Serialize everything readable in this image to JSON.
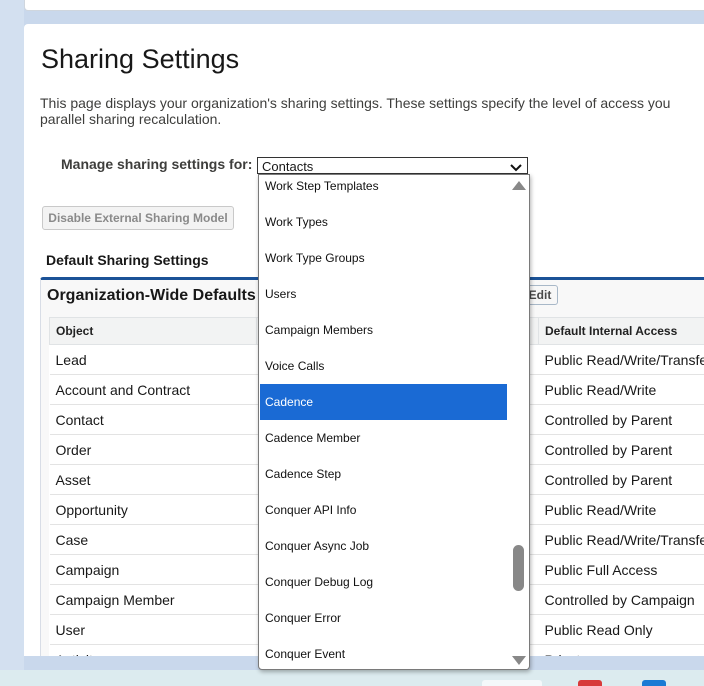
{
  "page": {
    "title": "Sharing Settings",
    "description_line1": "This page displays your organization's sharing settings. These settings specify the level of access you",
    "description_line2": "parallel sharing recalculation."
  },
  "manage": {
    "label": "Manage sharing settings for:",
    "selected": "Contacts"
  },
  "buttons": {
    "disable_external": "Disable External Sharing Model",
    "edit": "Edit"
  },
  "section": {
    "default_sharing": "Default Sharing Settings",
    "owd_title": "Organization-Wide Defaults"
  },
  "table": {
    "headers": [
      "Object",
      "",
      "Default Internal Access"
    ],
    "rows": [
      {
        "object": "Lead",
        "access": "Public Read/Write/Transfer"
      },
      {
        "object": "Account and Contract",
        "access": "Public Read/Write"
      },
      {
        "object": "Contact",
        "access": "Controlled by Parent"
      },
      {
        "object": "Order",
        "access": "Controlled by Parent"
      },
      {
        "object": "Asset",
        "access": "Controlled by Parent"
      },
      {
        "object": "Opportunity",
        "access": "Public Read/Write"
      },
      {
        "object": "Case",
        "access": "Public Read/Write/Transfer"
      },
      {
        "object": "Campaign",
        "access": "Public Full Access"
      },
      {
        "object": "Campaign Member",
        "access": "Controlled by Campaign"
      },
      {
        "object": "User",
        "access": "Public Read Only"
      },
      {
        "object": "Activity",
        "access": "Private"
      }
    ]
  },
  "dropdown": {
    "items": [
      "Work Step Templates",
      "Work Types",
      "Work Type Groups",
      "Users",
      "Campaign Members",
      "Voice Calls",
      "Cadence",
      "Cadence Member",
      "Cadence Step",
      "Conquer API Info",
      "Conquer Async Job",
      "Conquer Debug Log",
      "Conquer Error",
      "Conquer Event"
    ],
    "highlighted": "Cadence"
  },
  "colors": {
    "highlight": "#1a6ad4",
    "panel_border": "#1b5297"
  },
  "icons": [
    "chevron-down-icon",
    "scroll-up-arrow-icon",
    "scroll-down-arrow-icon"
  ]
}
